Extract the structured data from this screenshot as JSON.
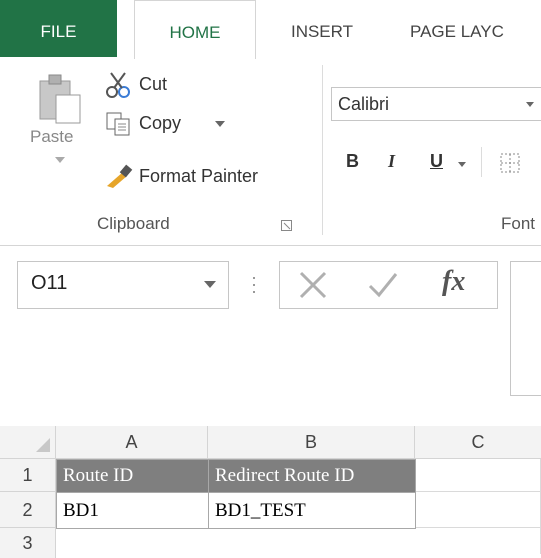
{
  "tabs": {
    "file": "FILE",
    "home": "HOME",
    "insert": "INSERT",
    "page_layout": "PAGE LAYC"
  },
  "clipboard": {
    "paste": "Paste",
    "cut": "Cut",
    "copy": "Copy",
    "format_painter": "Format Painter",
    "group_label": "Clipboard"
  },
  "font": {
    "font_name": "Calibri",
    "bold": "B",
    "italic": "I",
    "underline": "U",
    "group_label": "Font"
  },
  "formula_bar": {
    "name_box": "O11",
    "fx": "fx"
  },
  "grid": {
    "columns": [
      "A",
      "B",
      "C"
    ],
    "rows": [
      "1",
      "2",
      "3"
    ],
    "cells": {
      "A1": "Route ID",
      "B1": "Redirect Route ID",
      "A2": "BD1",
      "B2": "BD1_TEST"
    }
  },
  "colors": {
    "accent": "#217346",
    "header_fill": "#7f7f7f"
  }
}
